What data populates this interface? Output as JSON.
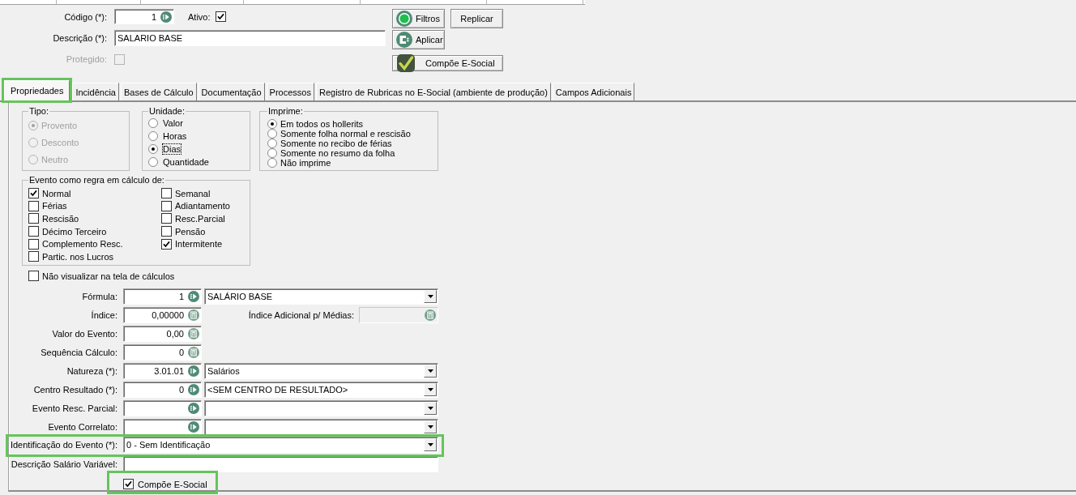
{
  "header": {
    "code": {
      "label": "Código (*):",
      "value": "1"
    },
    "active": {
      "label": "Ativo:",
      "checked": true
    },
    "description": {
      "label": "Descrição (*):",
      "value": "SALARIO BASE"
    },
    "protected": {
      "label": "Protegido:",
      "checked": false,
      "disabled": true
    },
    "buttons": [
      {
        "kind": "filter",
        "label": "Filtros"
      },
      {
        "kind": "replicate",
        "label": "Replicar"
      },
      {
        "kind": "apply",
        "label": "Aplicar"
      },
      {
        "kind": "esocial",
        "label": "Compõe E-Social"
      }
    ]
  },
  "tabs": [
    {
      "label": "Propriedades",
      "selected": true,
      "highlighted": true
    },
    {
      "label": "Incidência",
      "selected": false,
      "highlighted": false
    },
    {
      "label": "Bases de Cálculo",
      "selected": false,
      "highlighted": false
    },
    {
      "label": "Documentação",
      "selected": false,
      "highlighted": false
    },
    {
      "label": "Processos",
      "selected": false,
      "highlighted": false
    },
    {
      "label": "Registro de Rubricas no E-Social (ambiente de produção)",
      "selected": false,
      "highlighted": false
    },
    {
      "label": "Campos Adicionais",
      "selected": false,
      "highlighted": false
    }
  ],
  "type_group": {
    "title": "Tipo:",
    "disabled": true,
    "options": [
      {
        "label": "Provento",
        "selected": true
      },
      {
        "label": "Desconto",
        "selected": false
      },
      {
        "label": "Neutro",
        "selected": false
      }
    ]
  },
  "unit_group": {
    "title": "Unidade:",
    "disabled": false,
    "options": [
      {
        "label": "Valor",
        "selected": false,
        "focused": false
      },
      {
        "label": "Horas",
        "selected": false,
        "focused": false
      },
      {
        "label": "Dias",
        "selected": true,
        "focused": true
      },
      {
        "label": "Quantidade",
        "selected": false,
        "focused": false
      }
    ]
  },
  "print_group": {
    "title": "Imprime:",
    "disabled": false,
    "options": [
      {
        "label": "Em todos os hollerits",
        "selected": true
      },
      {
        "label": "Somente folha normal e rescisão",
        "selected": false
      },
      {
        "label": "Somente no recibo de férias",
        "selected": false
      },
      {
        "label": "Somente no resumo da folha",
        "selected": false
      },
      {
        "label": "Não imprime",
        "selected": false
      }
    ]
  },
  "calc_group": {
    "title": "Evento como regra em cálculo de:",
    "columns": [
      {
        "items": [
          {
            "label": "Normal",
            "checked": true
          },
          {
            "label": "Férias",
            "checked": false
          },
          {
            "label": "Rescisão",
            "checked": false
          },
          {
            "label": "Décimo Terceiro",
            "checked": false
          },
          {
            "label": "Complemento Resc.",
            "checked": false
          },
          {
            "label": "Partic. nos Lucros",
            "checked": false
          }
        ]
      },
      {
        "items": [
          {
            "label": "Semanal",
            "checked": false
          },
          {
            "label": "Adiantamento",
            "checked": false
          },
          {
            "label": "Resc.Parcial",
            "checked": false
          },
          {
            "label": "Pensão",
            "checked": false
          },
          {
            "label": "Intermitente",
            "checked": true
          }
        ]
      }
    ]
  },
  "hide_in_calc": {
    "label": "Não visualizar na tela de cálculos",
    "checked": false
  },
  "fields": [
    {
      "kind": "lookup",
      "label": "Fórmula:",
      "code": "1",
      "description": "SALÁRIO BASE",
      "highlighted": false
    },
    {
      "kind": "number",
      "label": "Índice:",
      "value": "0,00000",
      "extra": {
        "label": "Índice Adicional p/ Médias:",
        "disabled": true
      },
      "highlighted": false
    },
    {
      "kind": "number",
      "label": "Valor do Evento:",
      "value": "0,00",
      "highlighted": false
    },
    {
      "kind": "number",
      "label": "Sequência Cálculo:",
      "value": "0",
      "highlighted": false
    },
    {
      "kind": "lookup",
      "label": "Natureza (*):",
      "code": "3.01.01",
      "description": "Salários",
      "highlighted": false
    },
    {
      "kind": "lookup",
      "label": "Centro Resultado (*):",
      "code": "0",
      "description": "<SEM CENTRO DE RESULTADO>",
      "highlighted": false
    },
    {
      "kind": "lookup",
      "label": "Evento Resc. Parcial:",
      "highlighted": false
    },
    {
      "kind": "lookup",
      "label": "Evento Correlato:",
      "highlighted": false
    },
    {
      "kind": "combo",
      "label": "Identificação do Evento (*):",
      "value": "0 - Sem Identificação",
      "highlighted": true
    },
    {
      "kind": "text",
      "label": "Descrição Salário Variável:",
      "highlighted": false
    }
  ],
  "compose_esocial": {
    "label": "Compõe E-Social",
    "checked": true,
    "highlighted": true
  }
}
